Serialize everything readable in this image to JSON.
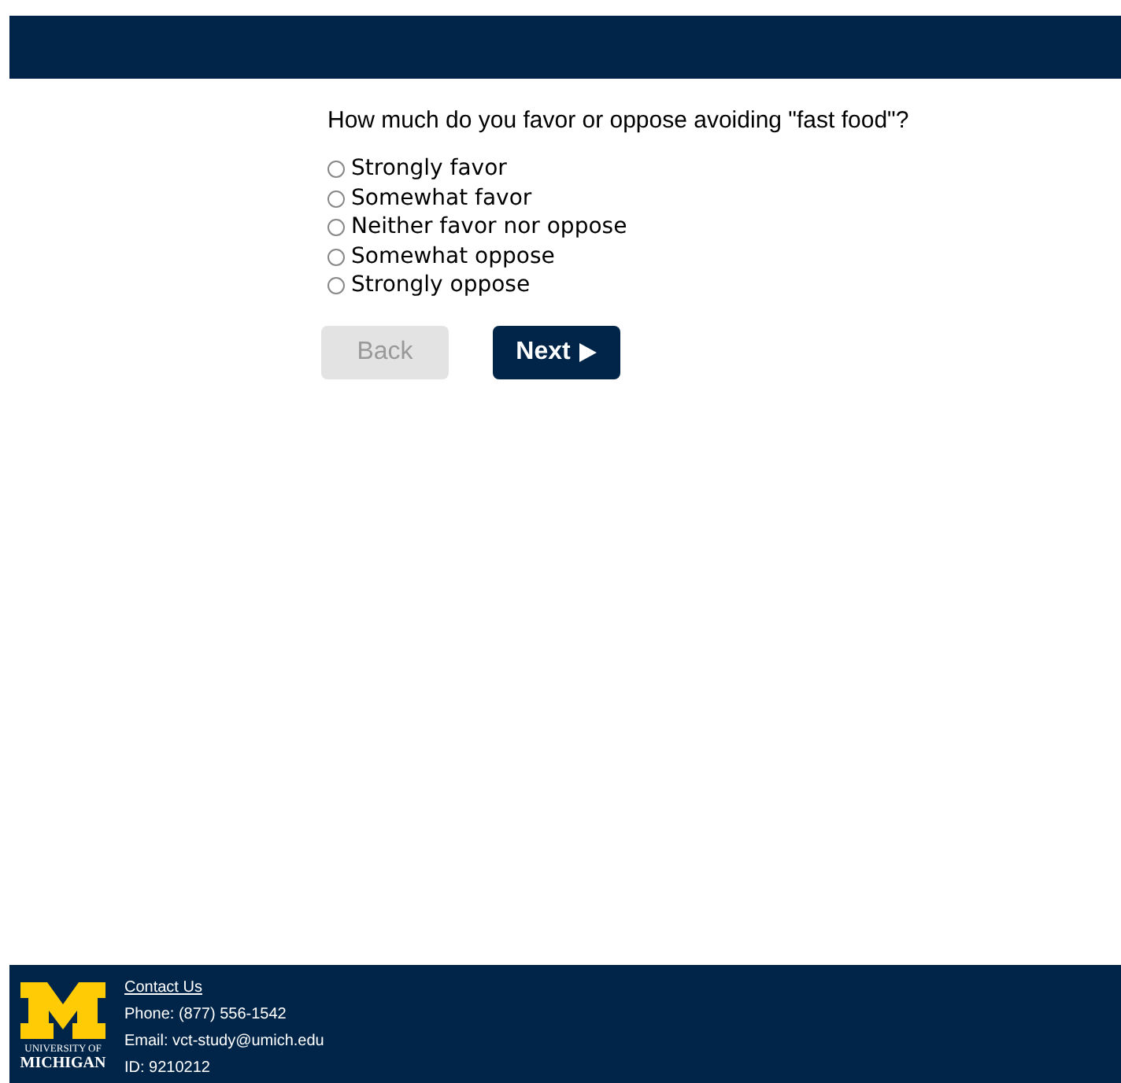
{
  "question": {
    "text": "How much do you favor or oppose avoiding \"fast food\"?"
  },
  "options": [
    {
      "label": "Strongly favor",
      "selected": false
    },
    {
      "label": "Somewhat favor",
      "selected": false
    },
    {
      "label": "Neither favor nor oppose",
      "selected": false
    },
    {
      "label": "Somewhat oppose",
      "selected": false
    },
    {
      "label": "Strongly oppose",
      "selected": false
    }
  ],
  "buttons": [
    {
      "label": "Back",
      "disabled": true,
      "arrow": false
    },
    {
      "label": "Next",
      "disabled": false,
      "arrow": true
    }
  ],
  "footer": {
    "logo_lines": [
      "UNIVERSITY OF",
      "MICHIGAN"
    ],
    "contact_link": "Contact Us",
    "phone": "Phone: (877) 556-1542",
    "email": "Email: vct-study@umich.edu",
    "id": "ID: 9210212"
  }
}
